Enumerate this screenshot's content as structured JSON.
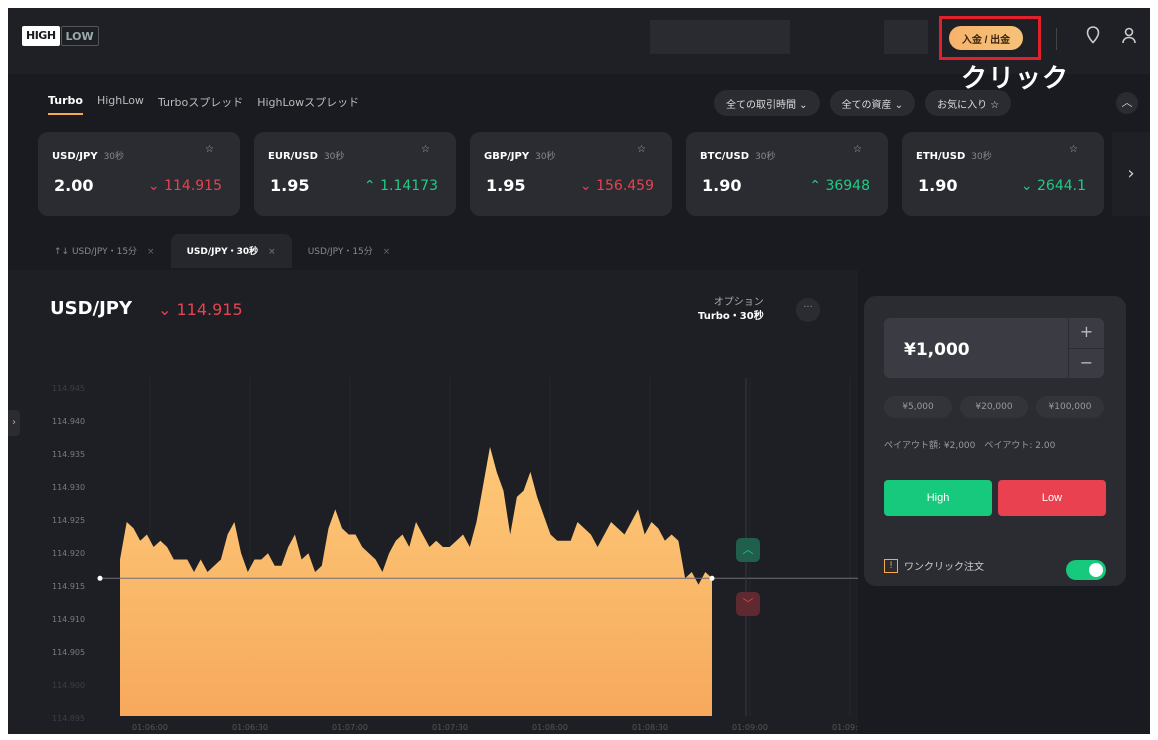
{
  "logo": {
    "high": "HIGH",
    "low": "LOW"
  },
  "header": {
    "deposit_label": "入金 / 出金",
    "annotation": "クリック"
  },
  "product_tabs": [
    {
      "label": "Turbo",
      "active": true
    },
    {
      "label": "HighLow",
      "active": false
    },
    {
      "label": "Turboスプレッド",
      "active": false
    },
    {
      "label": "HighLowスプレッド",
      "active": false
    }
  ],
  "filters": {
    "trading_time": "全ての取引時間 ⌄",
    "assets": "全ての資産 ⌄",
    "favorites": "お気に入り ☆"
  },
  "assets": [
    {
      "pair": "USD/JPY",
      "period": "30秒",
      "payout": "2.00",
      "price": "⌄ 114.915",
      "direction": "down"
    },
    {
      "pair": "EUR/USD",
      "period": "30秒",
      "payout": "1.95",
      "price": "⌃ 1.14173",
      "direction": "up"
    },
    {
      "pair": "GBP/JPY",
      "period": "30秒",
      "payout": "1.95",
      "price": "⌄ 156.459",
      "direction": "down"
    },
    {
      "pair": "BTC/USD",
      "period": "30秒",
      "payout": "1.90",
      "price": "⌃ 36948",
      "direction": "up"
    },
    {
      "pair": "ETH/USD",
      "period": "30秒",
      "payout": "1.90",
      "price": "⌄ 2644.1",
      "direction": "up"
    }
  ],
  "chart_tabs": [
    {
      "label": "↑↓ USD/JPY・15分",
      "active": false
    },
    {
      "label": "USD/JPY・30秒",
      "active": true
    },
    {
      "label": "USD/JPY・15分",
      "active": false
    }
  ],
  "chart_header": {
    "symbol": "USD/JPY",
    "price": "⌄ 114.915",
    "option_label": "オプション",
    "option_value": "Turbo・30秒"
  },
  "trade_panel": {
    "amount": "¥1,000",
    "plus": "+",
    "minus": "−",
    "presets": [
      "¥5,000",
      "¥20,000",
      "¥100,000"
    ],
    "payout_info": "ペイアウト額: ¥2,000　ペイアウト: 2.00",
    "high_label": "High",
    "low_label": "Low",
    "one_click_label": "ワンクリック注文",
    "one_click_enabled": true
  },
  "colors": {
    "accent": "#f7a84a",
    "up": "#1fcb82",
    "down": "#e5434f",
    "high_button": "#16c97d",
    "low_button": "#e9414f"
  },
  "chart_data": {
    "type": "area",
    "yticks": [
      "114.945",
      "114.940",
      "114.935",
      "114.930",
      "114.925",
      "114.920",
      "114.915",
      "114.910",
      "114.905",
      "114.900",
      "114.895"
    ],
    "xticks": [
      "01:06:00",
      "01:06:30",
      "01:07:00",
      "01:07:30",
      "01:08:00",
      "01:08:30",
      "01:09:00",
      "01:09:30"
    ],
    "ylim": [
      114.893,
      114.947
    ],
    "current_value": 114.915,
    "values": [
      114.918,
      114.924,
      114.923,
      114.921,
      114.922,
      114.92,
      114.921,
      114.92,
      114.918,
      114.918,
      114.918,
      114.916,
      114.918,
      114.916,
      114.917,
      114.918,
      114.922,
      114.924,
      114.919,
      114.916,
      114.918,
      114.918,
      114.919,
      114.917,
      114.917,
      114.92,
      114.922,
      114.918,
      114.919,
      114.916,
      114.917,
      114.923,
      114.926,
      114.923,
      114.922,
      114.922,
      114.92,
      114.919,
      114.918,
      114.916,
      114.919,
      114.921,
      114.922,
      114.92,
      114.924,
      114.922,
      114.92,
      114.921,
      114.92,
      114.92,
      114.921,
      114.922,
      114.92,
      114.924,
      114.93,
      114.936,
      114.932,
      114.929,
      114.922,
      114.928,
      114.929,
      114.932,
      114.928,
      114.925,
      114.922,
      114.921,
      114.921,
      114.921,
      114.924,
      114.923,
      114.922,
      114.92,
      114.922,
      114.924,
      114.923,
      114.922,
      114.924,
      114.926,
      114.922,
      114.924,
      114.923,
      114.921,
      114.922,
      114.921,
      114.915,
      114.916,
      114.914,
      114.916,
      114.915
    ]
  }
}
